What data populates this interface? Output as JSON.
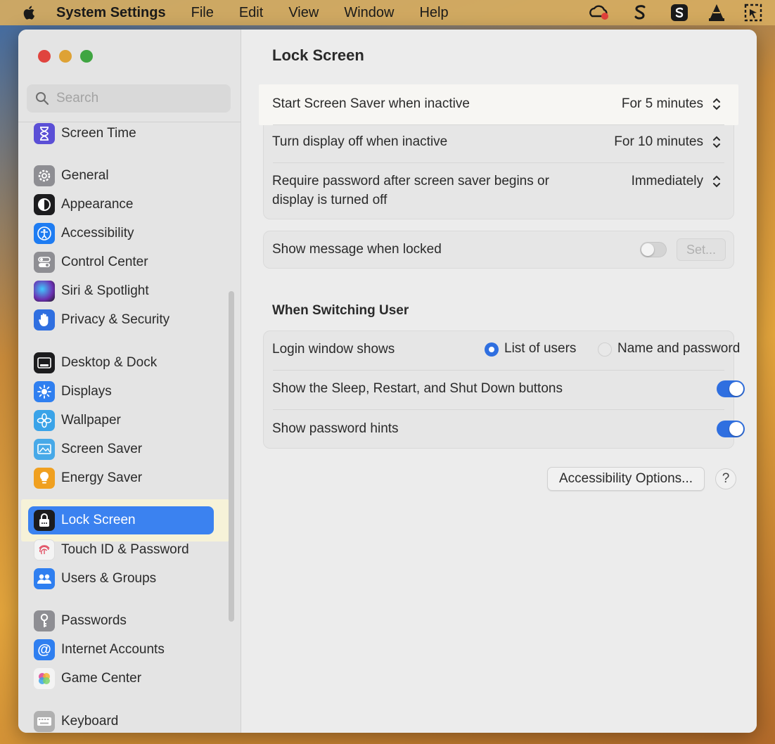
{
  "menubar": {
    "app_name": "System Settings",
    "items": [
      "File",
      "Edit",
      "View",
      "Window",
      "Help"
    ]
  },
  "sidebar": {
    "search_placeholder": "Search",
    "items": [
      {
        "label": "Screen Time",
        "icon": "hourglass-icon",
        "color": "#5b4fd6"
      },
      {
        "label": "General",
        "icon": "gear-icon",
        "color": "#8e8e93"
      },
      {
        "label": "Appearance",
        "icon": "appearance-icon",
        "color": "#1c1c1e"
      },
      {
        "label": "Accessibility",
        "icon": "accessibility-icon",
        "color": "#1e7cf2"
      },
      {
        "label": "Control Center",
        "icon": "control-center-icon",
        "color": "#8e8e93"
      },
      {
        "label": "Siri & Spotlight",
        "icon": "siri-icon",
        "color": "#6b2fb0"
      },
      {
        "label": "Privacy & Security",
        "icon": "hand-icon",
        "color": "#2f6fe0"
      },
      {
        "label": "Desktop & Dock",
        "icon": "dock-icon",
        "color": "#1c1c1e"
      },
      {
        "label": "Displays",
        "icon": "sun-icon",
        "color": "#2f7ff0"
      },
      {
        "label": "Wallpaper",
        "icon": "flower-icon",
        "color": "#3aa3e8"
      },
      {
        "label": "Screen Saver",
        "icon": "screen-saver-icon",
        "color": "#47a9e8"
      },
      {
        "label": "Energy Saver",
        "icon": "lightbulb-icon",
        "color": "#f0a020"
      },
      {
        "label": "Lock Screen",
        "icon": "lock-icon",
        "color": "#1c1c1e"
      },
      {
        "label": "Touch ID & Password",
        "icon": "fingerprint-icon",
        "color": "#f4f4f4"
      },
      {
        "label": "Users & Groups",
        "icon": "users-icon",
        "color": "#2f7ff0"
      },
      {
        "label": "Passwords",
        "icon": "key-icon",
        "color": "#8e8e93"
      },
      {
        "label": "Internet Accounts",
        "icon": "at-icon",
        "color": "#2f7ff0"
      },
      {
        "label": "Game Center",
        "icon": "game-center-icon",
        "color": "#e05aa0"
      },
      {
        "label": "Keyboard",
        "icon": "keyboard-icon",
        "color": "#b0b0b0"
      }
    ],
    "selected": "Lock Screen"
  },
  "main": {
    "title": "Lock Screen",
    "group1": {
      "row1": {
        "label": "Start Screen Saver when inactive",
        "value": "For 5 minutes"
      },
      "row2": {
        "label": "Turn display off when inactive",
        "value": "For 10 minutes"
      },
      "row3": {
        "label_line1": "Require password after screen saver begins or",
        "label_line2": "display is turned off",
        "value": "Immediately"
      }
    },
    "group2": {
      "label": "Show message when locked",
      "toggle": "off",
      "set_button": "Set..."
    },
    "switching": {
      "title": "When Switching User",
      "login_label": "Login window shows",
      "option1": "List of users",
      "option2": "Name and password",
      "selected_option": "List of users",
      "sleep_label": "Show the Sleep, Restart, and Shut Down buttons",
      "sleep_toggle": "on",
      "hints_label": "Show password hints",
      "hints_toggle": "on"
    },
    "accessibility_button": "Accessibility Options...",
    "help_button": "?"
  }
}
